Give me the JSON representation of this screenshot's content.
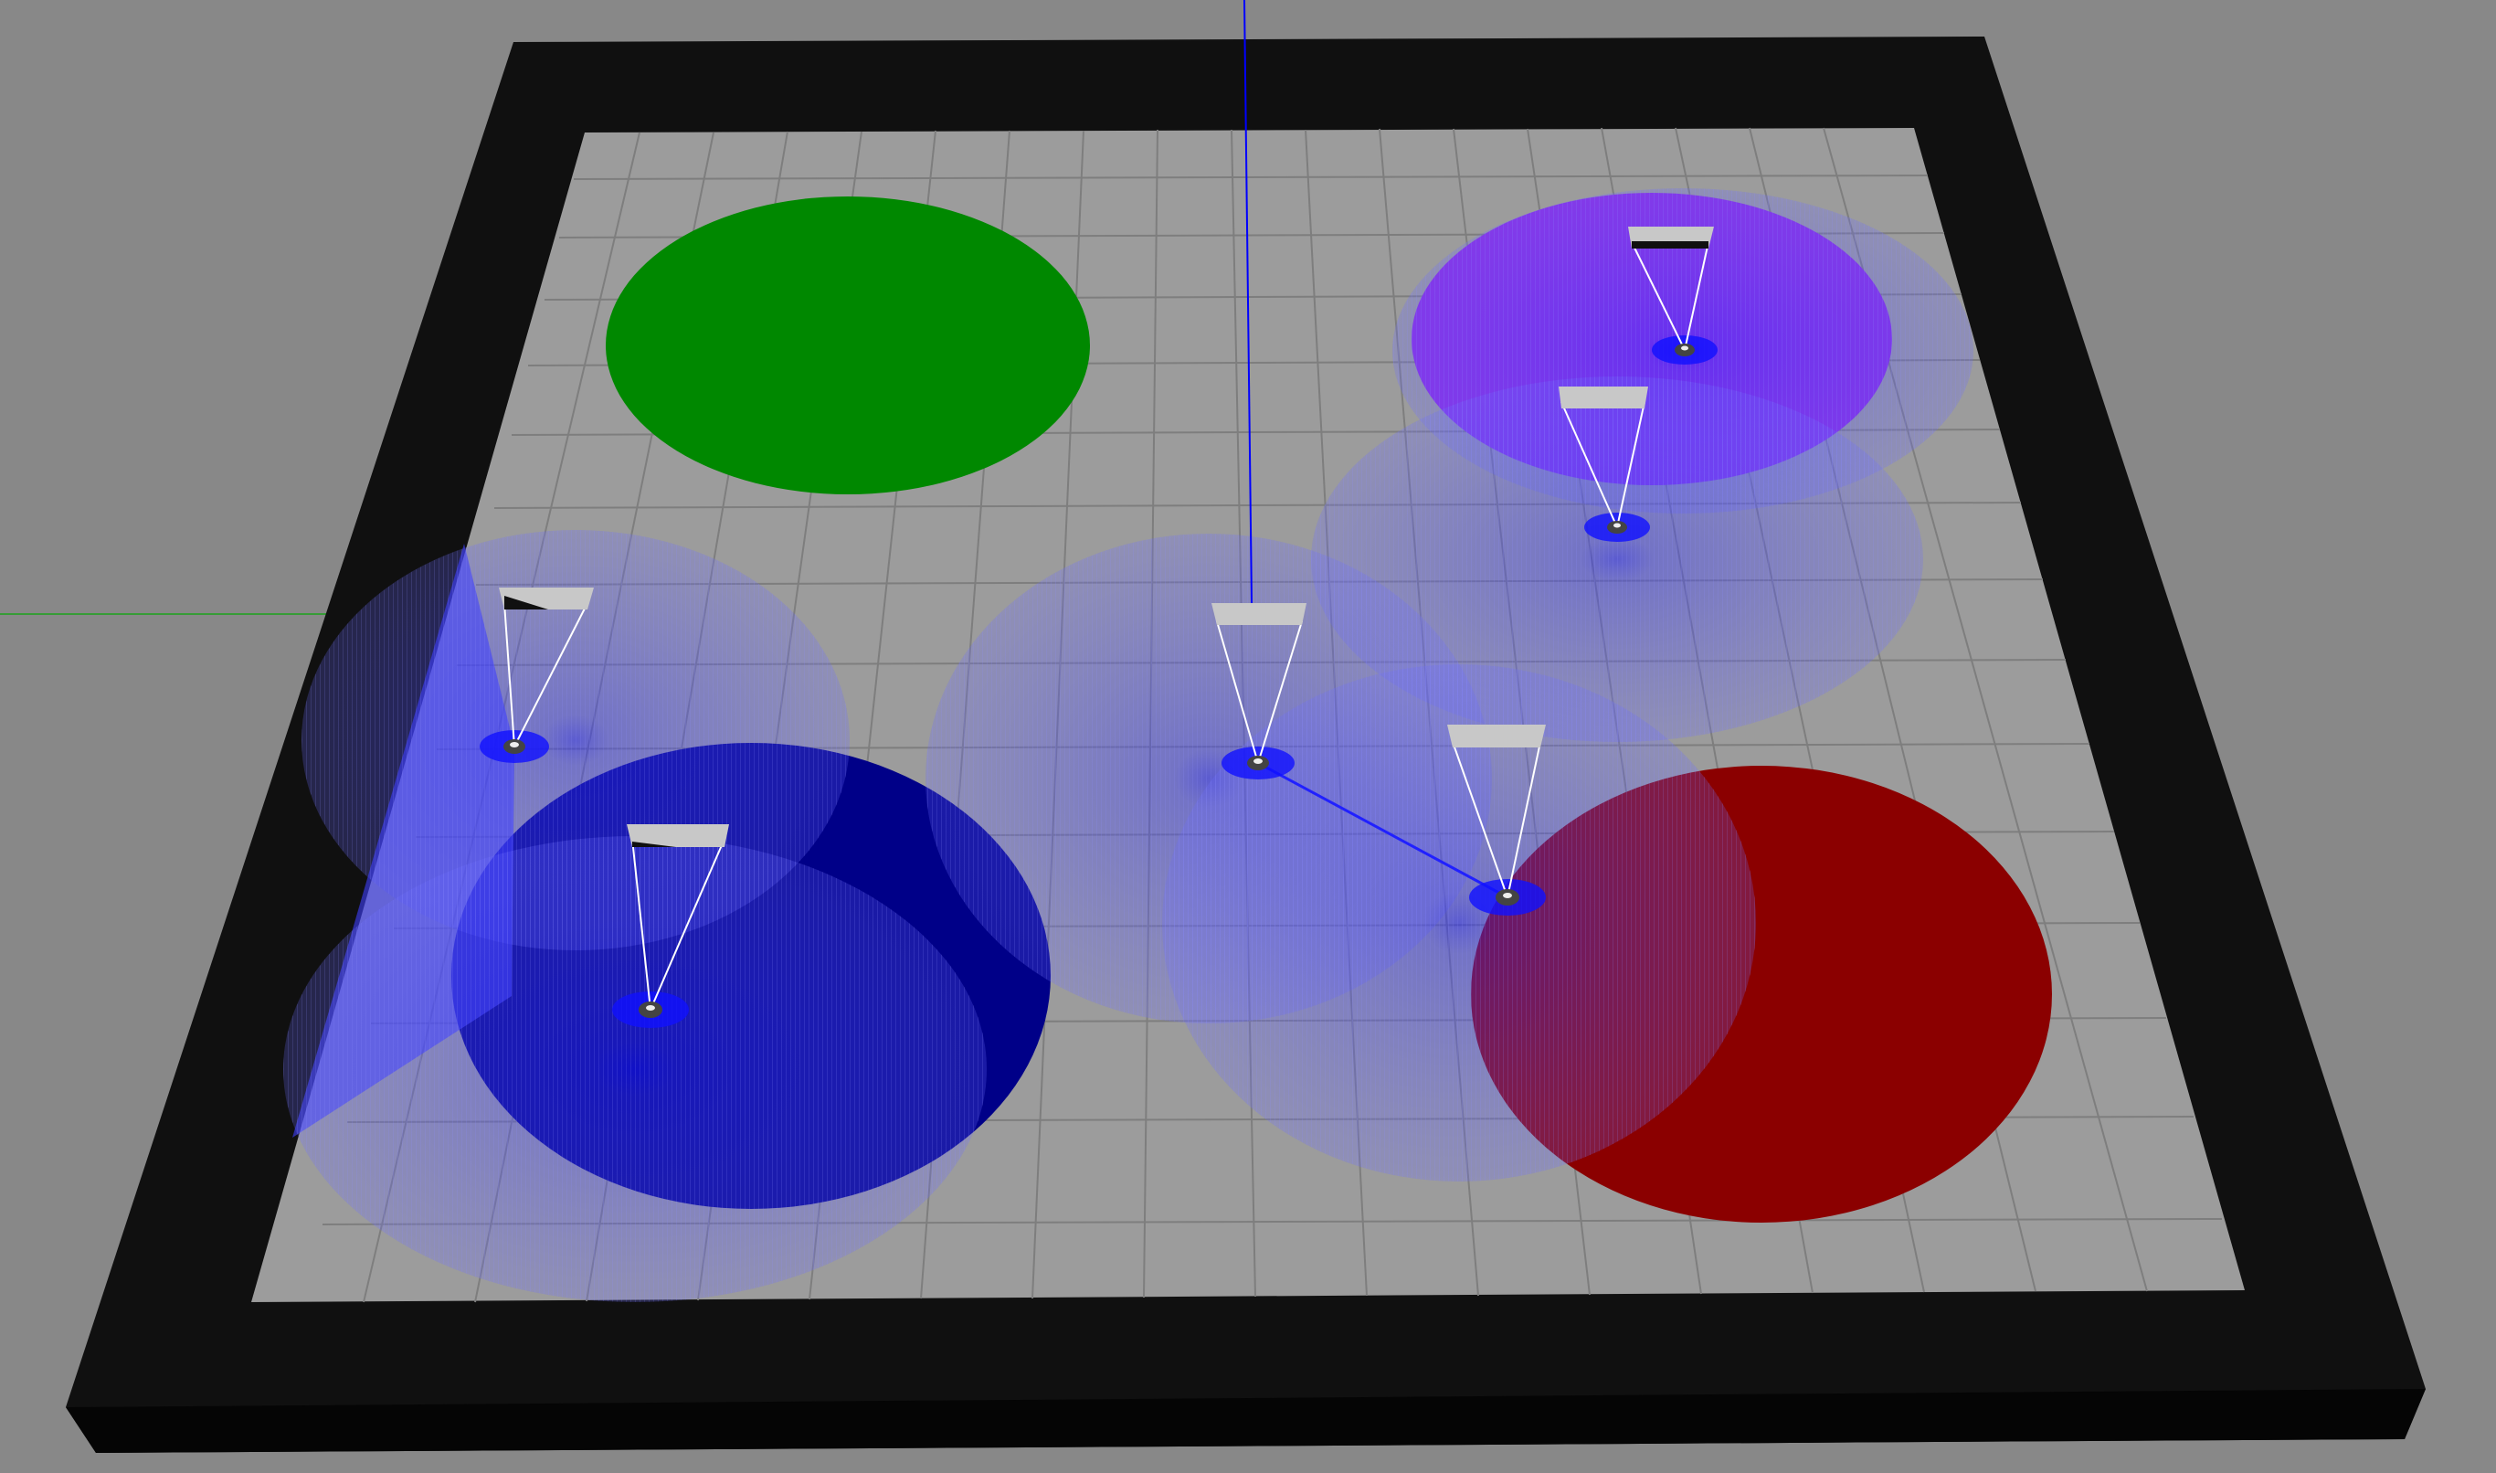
{
  "scene": {
    "background_color": "#888888",
    "wall_color": "#101010",
    "floor_color": "#9c9c9c",
    "grid_color": "#7e7e7e",
    "zones": [
      {
        "name": "green-zone",
        "color": "#008800"
      },
      {
        "name": "purple-zone",
        "color": "#8a2be2"
      },
      {
        "name": "dark-blue-zone",
        "color": "#000088"
      },
      {
        "name": "red-zone",
        "color": "#8b0000"
      }
    ],
    "robots": [
      {
        "name": "robot-left"
      },
      {
        "name": "robot-bottom-left"
      },
      {
        "name": "robot-center"
      },
      {
        "name": "robot-center-right"
      },
      {
        "name": "robot-top-right"
      },
      {
        "name": "robot-right-middle"
      }
    ],
    "sensor_color": "#3c3cff",
    "axis_colors": {
      "x": "#00aa00",
      "z": "#0000ff"
    }
  }
}
